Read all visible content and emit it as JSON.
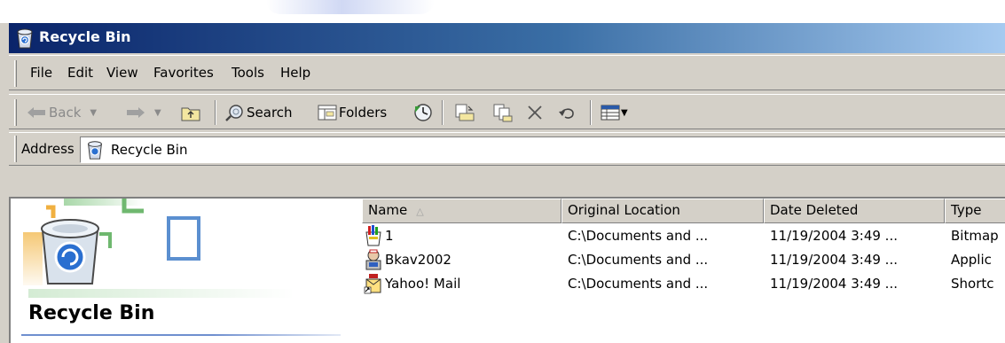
{
  "window": {
    "title": "Recycle Bin",
    "title_icon": "recycle-bin-icon"
  },
  "menu": {
    "items": [
      "File",
      "Edit",
      "View",
      "Favorites",
      "Tools",
      "Help"
    ]
  },
  "toolbar": {
    "back_label": "Back",
    "search_label": "Search",
    "folders_label": "Folders",
    "icons": [
      "back-arrow-icon",
      "forward-arrow-icon",
      "up-folder-icon",
      "search-icon",
      "folders-icon",
      "history-icon",
      "move-to-icon",
      "copy-to-icon",
      "delete-icon",
      "undo-icon",
      "views-icon"
    ]
  },
  "address": {
    "label": "Address",
    "value": "Recycle Bin"
  },
  "panel": {
    "title": "Recycle Bin"
  },
  "list": {
    "columns": [
      "Name",
      "Original Location",
      "Date Deleted",
      "Type"
    ],
    "sort_indicator": "△",
    "rows": [
      {
        "name": "1",
        "location": "C:\\Documents and ...",
        "date": "11/19/2004 3:49 ...",
        "type": "Bitmap",
        "icon": "paint-image-icon"
      },
      {
        "name": "Bkav2002",
        "location": "C:\\Documents and ...",
        "date": "11/19/2004 3:49 ...",
        "type": "Applic",
        "icon": "application-icon"
      },
      {
        "name": "Yahoo! Mail",
        "location": "C:\\Documents and ...",
        "date": "11/19/2004 3:49 ...",
        "type": "Shortc",
        "icon": "shortcut-icon"
      }
    ]
  },
  "colors": {
    "title_bar_start": "#0a246a",
    "title_bar_end": "#a6caf0",
    "chrome": "#d4d0c8"
  }
}
